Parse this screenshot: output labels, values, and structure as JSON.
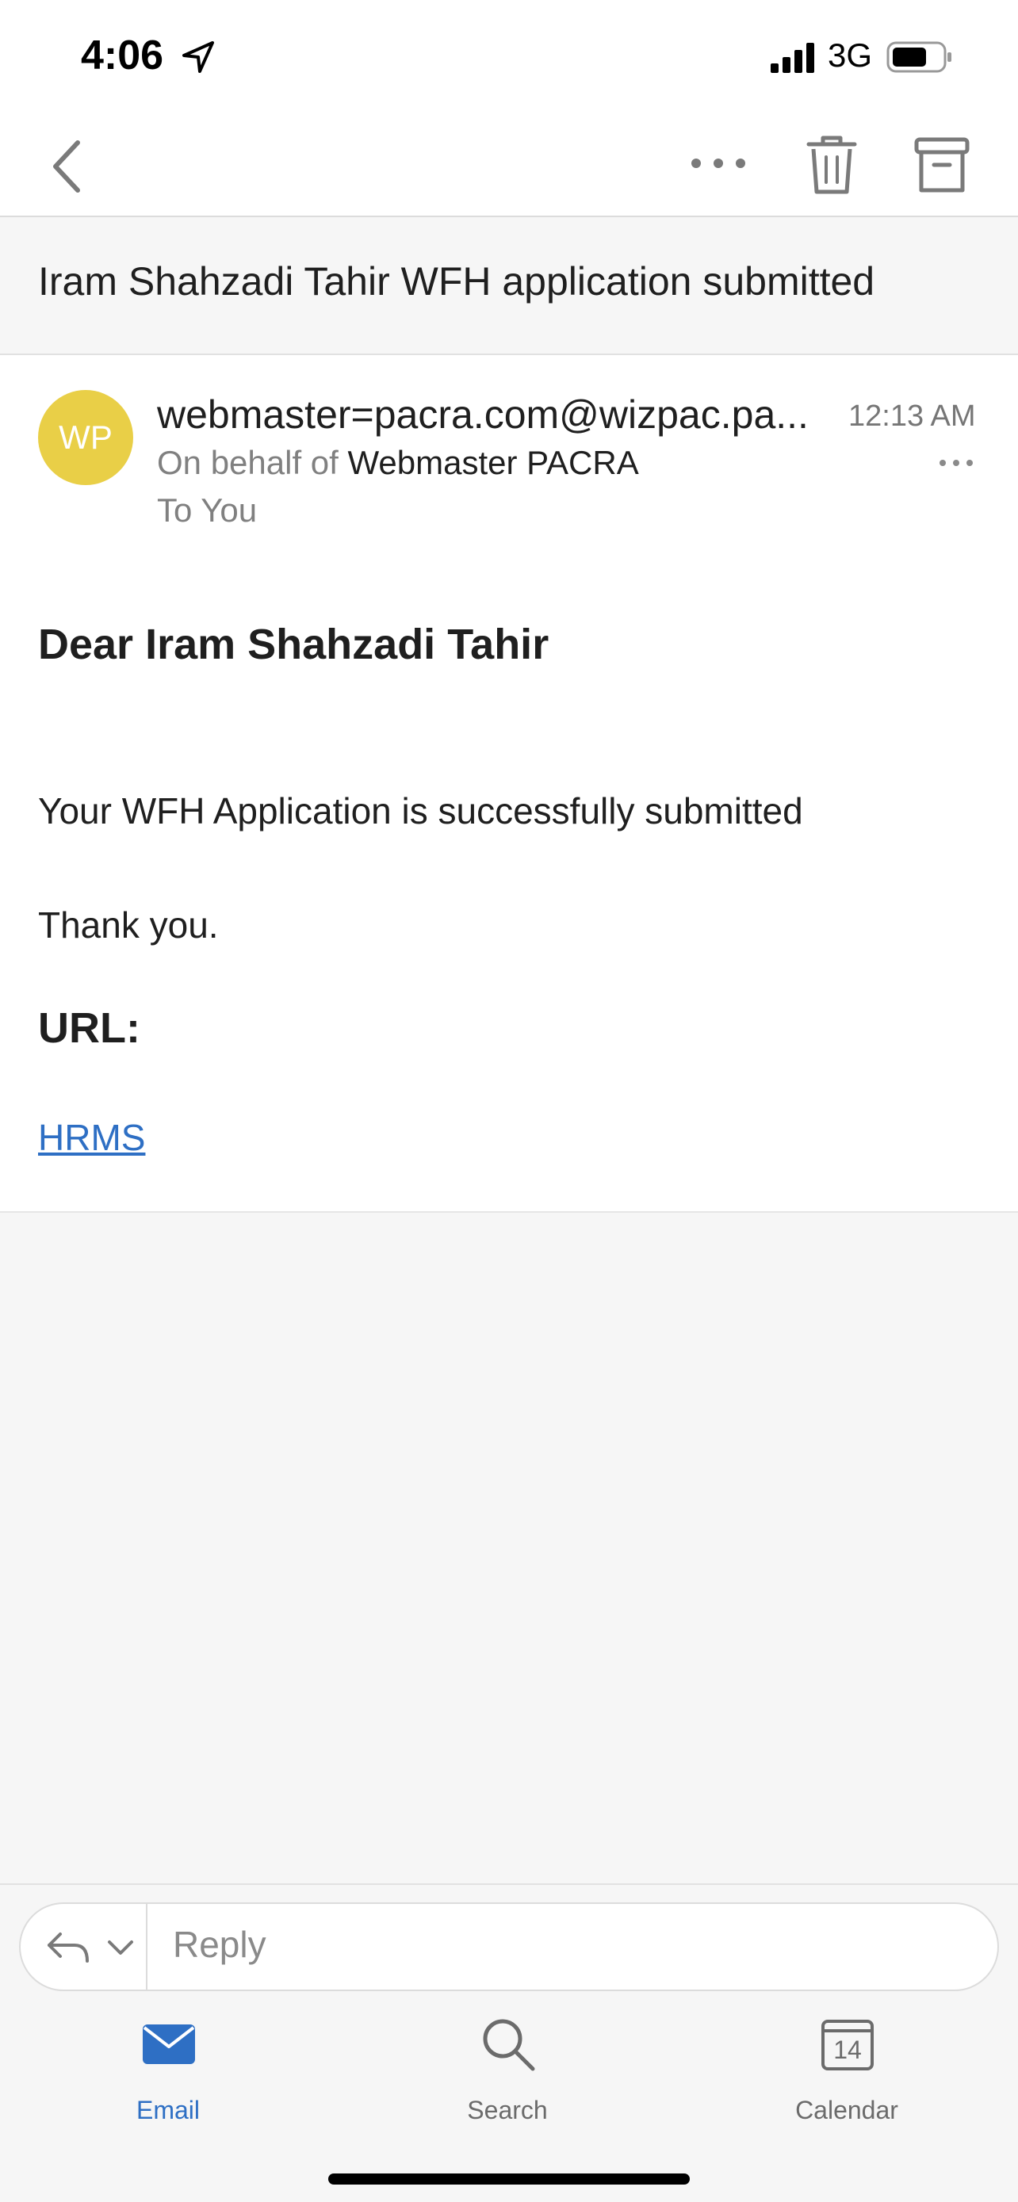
{
  "status_bar": {
    "time": "4:06",
    "network": "3G",
    "location_icon": "location-arrow-icon",
    "signal_icon": "signal-bars-icon",
    "battery_icon": "battery-icon"
  },
  "toolbar": {
    "back_icon": "chevron-left-icon",
    "more_icon": "ellipsis-icon",
    "delete_icon": "trash-icon",
    "archive_icon": "archive-icon"
  },
  "email": {
    "subject": "Iram Shahzadi Tahir WFH application submitted",
    "avatar_initials": "WP",
    "avatar_color": "#e9cf47",
    "sender": "webmaster=pacra.com@wizpac.pa...",
    "time": "12:13 AM",
    "behalf_prefix": "On behalf of",
    "behalf_name": "Webmaster PACRA",
    "to_line": "To You",
    "greeting": "Dear Iram Shahzadi Tahir",
    "body": "Your WFH Application is successfully submitted",
    "thanks": "Thank you.",
    "url_label": "URL:",
    "url_link": "HRMS"
  },
  "reply": {
    "placeholder": "Reply",
    "reply_icon": "reply-arrow-icon",
    "options_icon": "chevron-down-icon"
  },
  "tabs": [
    {
      "label": "Email",
      "icon": "envelope-icon",
      "active": true
    },
    {
      "label": "Search",
      "icon": "search-icon",
      "active": false
    },
    {
      "label": "Calendar",
      "icon": "calendar-icon",
      "day": "14",
      "active": false
    }
  ],
  "colors": {
    "accent": "#2e6fc4",
    "background": "#f6f6f6"
  }
}
